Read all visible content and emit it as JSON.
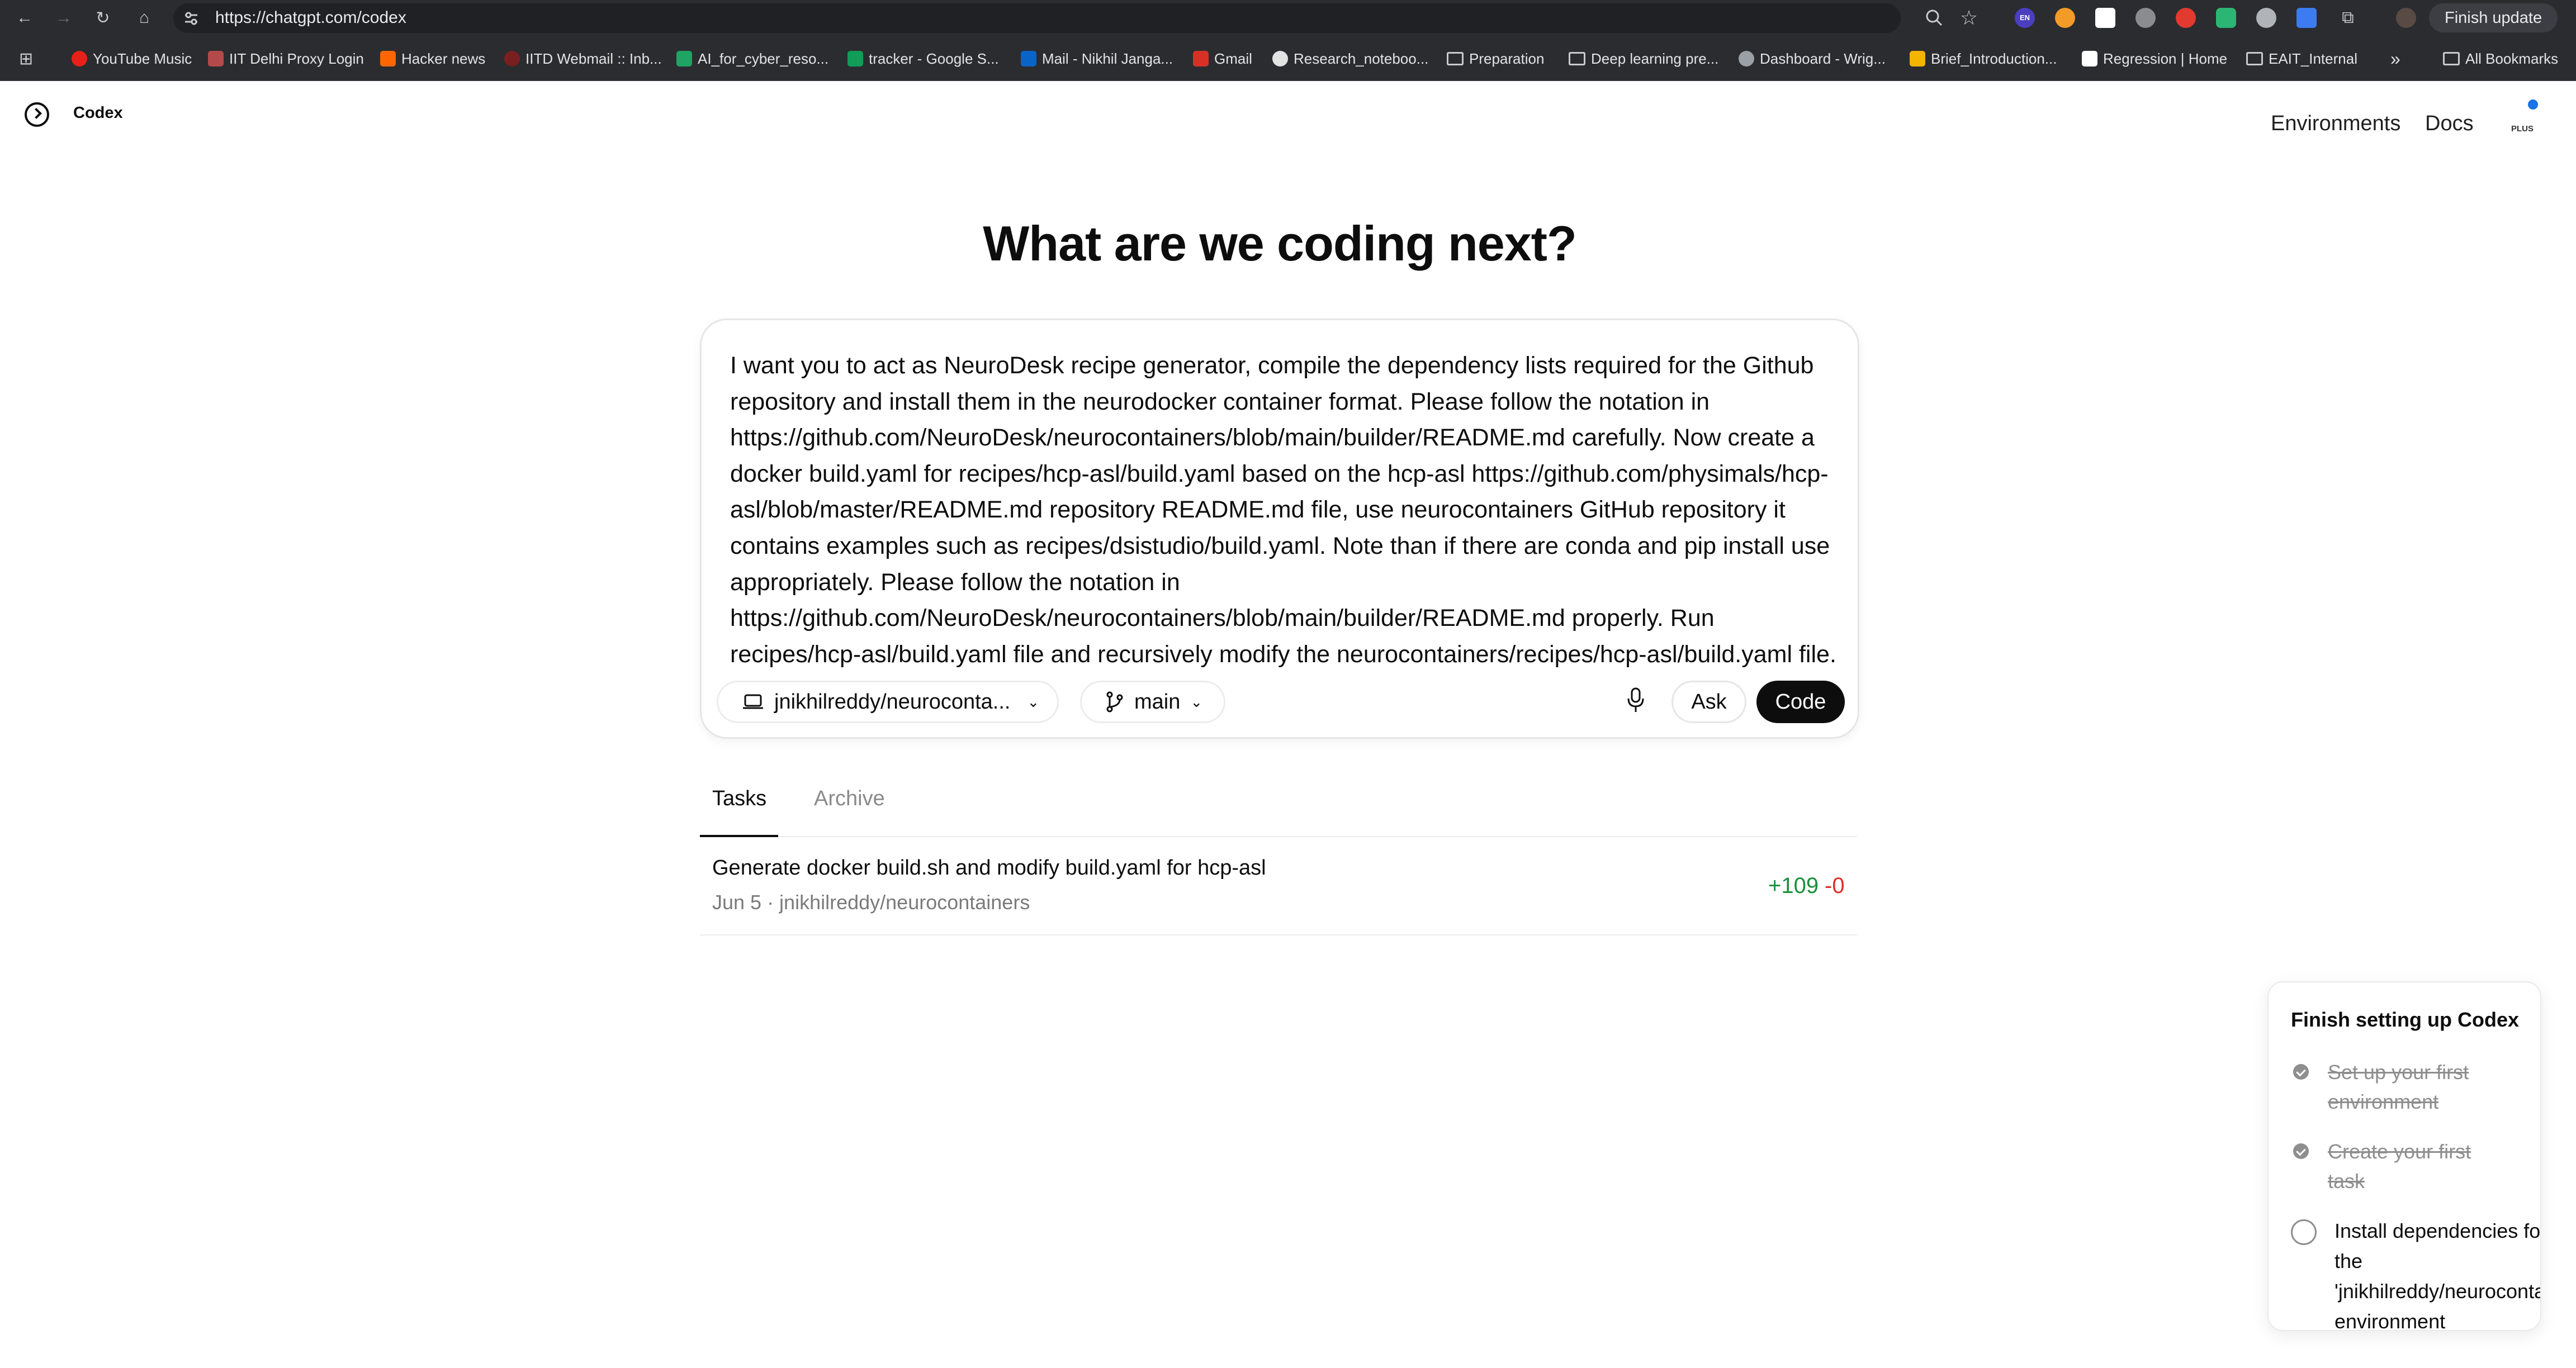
{
  "browser": {
    "url": "https://chatgpt.com/codex",
    "finish_update_label": "Finish update",
    "bookmarks": [
      "YouTube Music",
      "IIT Delhi Proxy Login",
      "Hacker news",
      "IITD Webmail :: Inb...",
      "AI_for_cyber_reso...",
      "tracker - Google S...",
      "Mail - Nikhil Janga...",
      "Gmail",
      "Research_noteboo...",
      "Preparation",
      "Deep learning pre...",
      "Dashboard - Wrig...",
      "Brief_Introduction...",
      "Regression | Home",
      "EAIT_Internal"
    ],
    "all_bookmarks_label": "All Bookmarks",
    "ext_badge": "EN",
    "more_label": "»"
  },
  "app": {
    "brand": "Codex",
    "nav": {
      "environments": "Environments",
      "docs": "Docs"
    },
    "avatar_badge": "PLUS"
  },
  "main": {
    "headline": "What are we coding next?",
    "prompt": "I want you to act as NeuroDesk recipe generator, compile the dependency lists required for the Github repository and install them in the neurodocker container format. Please follow the notation in https://github.com/NeuroDesk/neurocontainers/blob/main/builder/README.md carefully. Now create a docker build.yaml for recipes/hcp-asl/build.yaml based on the hcp-asl https://github.com/physimals/hcp-asl/blob/master/README.md repository README.md file, use neurocontainers GitHub repository it contains examples such as recipes/dsistudio/build.yaml. Note than if there are conda and pip install use appropriately. Please follow the notation in https://github.com/NeuroDesk/neurocontainers/blob/main/builder/README.md properly. Run recipes/hcp-asl/build.yaml file and recursively modify the neurocontainers/recipes/hcp-asl/build.yaml file.",
    "repo": "jnikhilreddy/neuroconta...",
    "branch": "main",
    "ask_label": "Ask",
    "code_label": "Code"
  },
  "tabs": {
    "tasks": "Tasks",
    "archive": "Archive"
  },
  "tasks": [
    {
      "title": "Generate docker build.sh and modify build.yaml for hcp-asl",
      "meta": "Jun 5 · jnikhilreddy/neurocontainers",
      "added": "+109",
      "removed": "-0"
    }
  ],
  "setup": {
    "title": "Finish setting up Codex",
    "steps": [
      {
        "label": "Set up your first environment",
        "done": true
      },
      {
        "label": "Create your first task",
        "done": true
      },
      {
        "label": "Install dependencies for the 'jnikhilreddy/neurocontainers' environment",
        "done": false
      }
    ]
  }
}
